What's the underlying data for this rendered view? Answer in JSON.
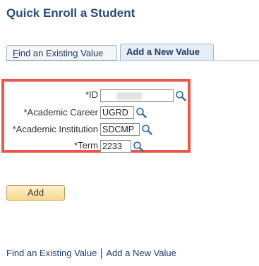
{
  "page": {
    "title": "Quick Enroll a Student"
  },
  "tabs": [
    {
      "label_underlined": "F",
      "label_rest": "ind an Existing Value"
    },
    {
      "label": "Add a New Value"
    }
  ],
  "form": {
    "id": {
      "label": "*ID",
      "value": ""
    },
    "career": {
      "label": "*Academic Career",
      "value": "UGRD"
    },
    "institution": {
      "label": "*Academic Institution",
      "value": "SDCMP"
    },
    "term": {
      "label": "*Term",
      "value": "2233"
    }
  },
  "actions": {
    "add_label": "Add"
  },
  "bottom_links": [
    {
      "label": "Find an Existing Value"
    },
    {
      "label": "Add a New Value"
    }
  ],
  "colors": {
    "highlight": "#e8574a",
    "title": "#2a4a7a",
    "link": "#1f3b66"
  },
  "icons": {
    "lookup": "magnifier-icon"
  }
}
